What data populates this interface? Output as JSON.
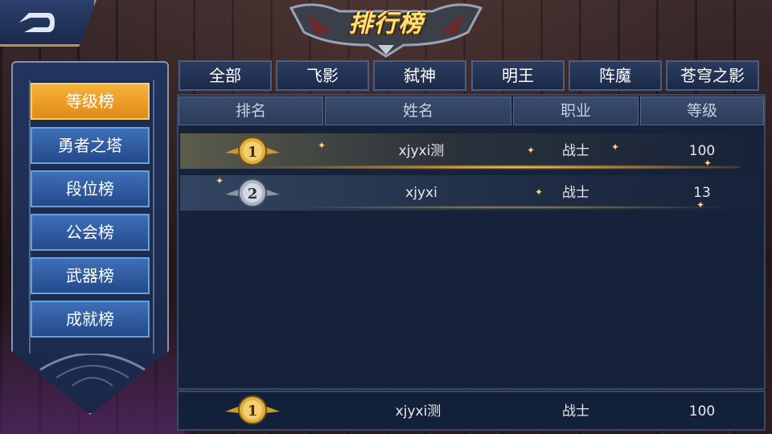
{
  "title": "排行榜",
  "sidebar": {
    "items": [
      {
        "label": "等级榜",
        "active": true
      },
      {
        "label": "勇者之塔",
        "active": false
      },
      {
        "label": "段位榜",
        "active": false
      },
      {
        "label": "公会榜",
        "active": false
      },
      {
        "label": "武器榜",
        "active": false
      },
      {
        "label": "成就榜",
        "active": false
      }
    ]
  },
  "tabs": [
    "全部",
    "飞影",
    "弑神",
    "明王",
    "阵魔",
    "苍穹之影"
  ],
  "table": {
    "headers": [
      "排名",
      "姓名",
      "职业",
      "等级"
    ],
    "rows": [
      {
        "rank": "1",
        "name": "xjyxi测",
        "class": "战士",
        "level": "100"
      },
      {
        "rank": "2",
        "name": "xjyxi",
        "class": "战士",
        "level": "13"
      }
    ]
  },
  "my_rank": {
    "rank": "1",
    "name": "xjyxi测",
    "class": "战士",
    "level": "100"
  },
  "colors": {
    "gold": "#f6b33a",
    "tab_bg": "#1c2a48",
    "panel_bg": "#16223a",
    "rank1_badge": "#e0b040",
    "rank2_badge": "#aab4c4"
  },
  "icons": {
    "back": "back-arrow-icon",
    "rank1": "gold-medal-icon",
    "rank2": "silver-medal-icon"
  }
}
